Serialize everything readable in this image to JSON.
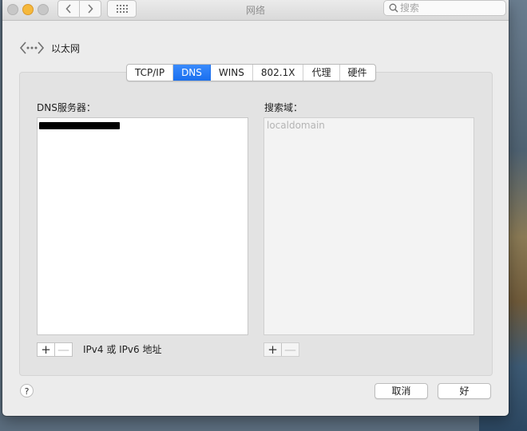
{
  "window": {
    "title": "网络"
  },
  "search": {
    "placeholder": "搜索"
  },
  "interface": {
    "name": "以太网"
  },
  "tabs": [
    {
      "label": "TCP/IP"
    },
    {
      "label": "DNS"
    },
    {
      "label": "WINS"
    },
    {
      "label": "802.1X"
    },
    {
      "label": "代理"
    },
    {
      "label": "硬件"
    }
  ],
  "active_tab": "DNS",
  "dns": {
    "servers_label": "DNS服务器：",
    "search_domains_label": "搜索域：",
    "search_domains": [
      "localdomain"
    ],
    "ip_hint": "IPv4 或 IPv6 地址",
    "add_label": "+",
    "remove_label": "—"
  },
  "buttons": {
    "cancel": "取消",
    "ok": "好",
    "help": "?"
  },
  "colors": {
    "accent": "#1a6fee",
    "close": "#c7c7c7",
    "minimize": "#f5b83b"
  },
  "icons": [
    "back-icon",
    "forward-icon",
    "grid-icon",
    "search-icon",
    "ethernet-icon",
    "help-icon"
  ]
}
